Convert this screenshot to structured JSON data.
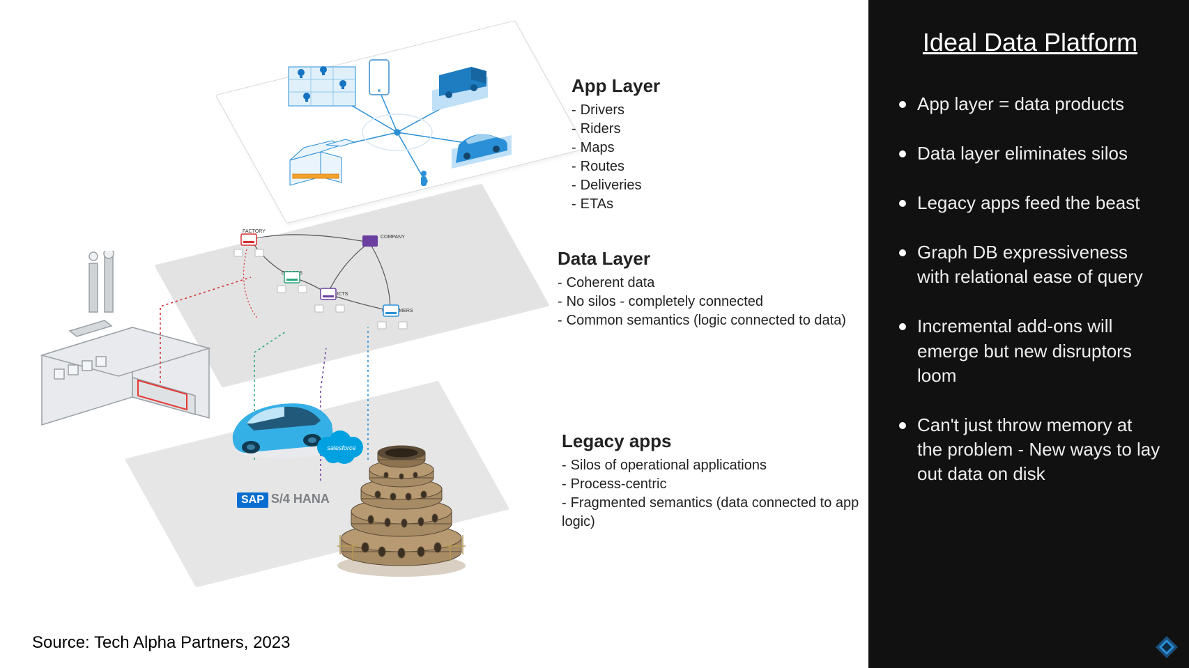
{
  "right": {
    "title": "Ideal Data Platform",
    "bullets": [
      "App layer = data products",
      "Data layer eliminates silos",
      "Legacy apps feed the beast",
      "Graph DB expressiveness with relational ease of query",
      "Incremental add-ons will emerge but new disruptors loom",
      "Can't just throw memory at the problem - New ways to lay out data on disk"
    ]
  },
  "source": "Source: Tech Alpha Partners, 2023",
  "layers": {
    "app": {
      "title": "App Layer",
      "items": [
        "Drivers",
        "Riders",
        "Maps",
        "Routes",
        "Deliveries",
        "ETAs"
      ]
    },
    "data": {
      "title": "Data Layer",
      "items": [
        "Coherent data",
        "No silos - completely connected",
        "Common semantics (logic connected to data)"
      ],
      "node_labels": [
        "FACTORY",
        "COMPANY",
        "ORDERS",
        "PRODUCTS",
        "CUSTOMERS"
      ]
    },
    "legacy": {
      "title": "Legacy apps",
      "items": [
        "Silos of operational applications",
        "Process-centric",
        "Fragmented semantics (data connected to app logic)"
      ],
      "sap": {
        "brand": "SAP",
        "product": "S/4 HANA"
      },
      "salesforce": "salesforce"
    }
  }
}
